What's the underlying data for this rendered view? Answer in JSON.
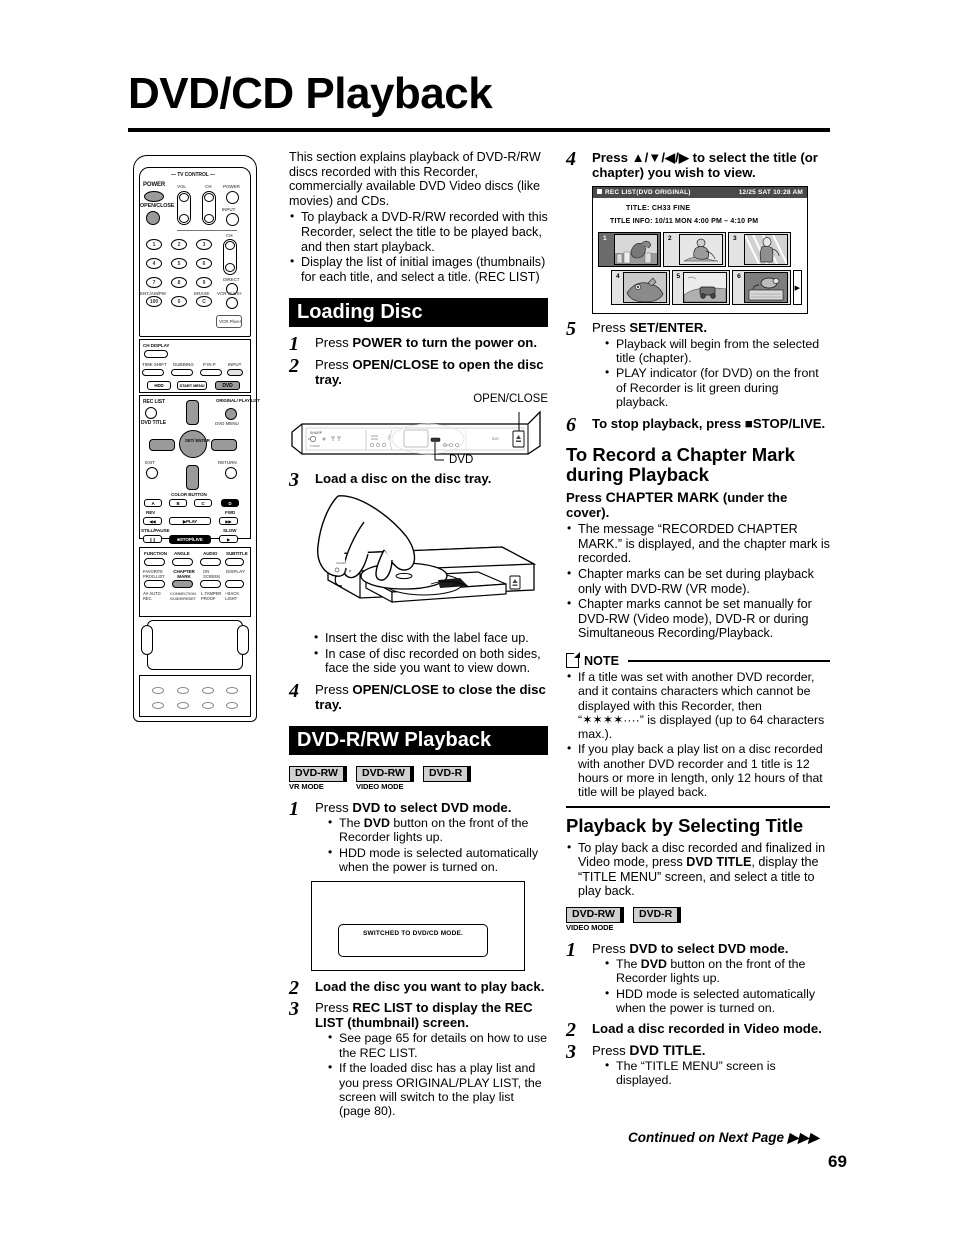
{
  "page": {
    "title": "DVD/CD Playback",
    "number": "69",
    "continued": "Continued on Next Page"
  },
  "intro": {
    "paragraph": "This section explains playback of DVD-R/RW discs recorded with this Recorder, commercially available DVD Video discs (like movies) and CDs.",
    "bullets": [
      "To playback a DVD-R/RW recorded with this Recorder, select the title to be played back, and then start playback.",
      "Display the list of initial images (thumbnails) for each title, and select a title. (REC LIST)"
    ]
  },
  "loading_disc": {
    "heading": "Loading Disc",
    "steps": [
      {
        "num": "1",
        "title_pre": "Press ",
        "title_bold": "POWER",
        "title_post": " to turn the power on."
      },
      {
        "num": "2",
        "title_pre": "Press ",
        "title_bold": "OPEN/CLOSE",
        "title_post": " to open the disc tray."
      },
      {
        "num": "3",
        "title_pre": "",
        "title_bold": "",
        "title_post": "Load a disc on the disc tray."
      },
      {
        "num": "4",
        "title_pre": "Press ",
        "title_bold": "OPEN/CLOSE",
        "title_post": " to close the disc tray."
      }
    ],
    "front_panel_labels": {
      "open_close": "OPEN/CLOSE",
      "dvd": "DVD"
    },
    "disc_bullets": [
      "Insert the disc with the label face up.",
      "In case of disc recorded on both sides, face the side you want to view down."
    ]
  },
  "dvd_rrw_playback": {
    "heading": "DVD-R/RW Playback",
    "badges": [
      {
        "label": "DVD-RW",
        "sub": "VR MODE"
      },
      {
        "label": "DVD-RW",
        "sub": "VIDEO MODE"
      },
      {
        "label": "DVD-R",
        "sub": ""
      }
    ],
    "step1": {
      "num": "1",
      "title_pre": "Press ",
      "title_bold": "DVD",
      "title_post": " to select DVD mode.",
      "bullets": [
        {
          "pre": "The ",
          "bold": "DVD",
          "post": " button on the front of the Recorder lights up."
        },
        {
          "pre": "",
          "bold": "",
          "post": "HDD mode is selected automatically when the power is turned on."
        }
      ],
      "osd_message": "SWITCHED TO DVD/CD MODE."
    },
    "step2": {
      "num": "2",
      "title": "Load the disc you want to play back."
    },
    "step3": {
      "num": "3",
      "title_pre": "Press ",
      "title_bold": "REC LIST",
      "title_post": " to display the REC LIST (thumbnail) screen.",
      "bullets": [
        "See page 65 for details on how to use the REC LIST.",
        "If the loaded disc has a play list and you press ORIGINAL/PLAY LIST, the screen will switch to the play list (page 80)."
      ]
    }
  },
  "right_column": {
    "step4": {
      "num": "4",
      "title": "Press ▲/▼/◀/▶ to select the title (or chapter) you wish to view."
    },
    "rec_list_osd": {
      "title": "REC LIST(DVD ORIGINAL)",
      "datetime": "12/25 SAT 10:28 AM",
      "title_line": "TITLE: CH33   FINE",
      "title_info": "TITLE INFO: 10/11 MON   4:00 PM – 4:10 PM",
      "thumbnails": [
        "1",
        "2",
        "3",
        "4",
        "5",
        "6"
      ],
      "selected_index": "1",
      "more_arrow": "▶"
    },
    "step5": {
      "num": "5",
      "title_pre": "Press ",
      "title_bold": "SET/ENTER",
      "title_post": ".",
      "bullets": [
        "Playback will begin from the selected title (chapter).",
        "PLAY indicator (for DVD) on the front of Recorder is lit green during playback."
      ]
    },
    "step6": {
      "num": "6",
      "title": "To stop playback, press ■STOP/LIVE."
    },
    "chapter_mark": {
      "heading": "To Record a Chapter Mark during Playback",
      "instruction_pre": "Press ",
      "instruction_bold": "CHAPTER MARK",
      "instruction_post": " (under the cover).",
      "bullets": [
        "The message “RECORDED CHAPTER MARK.” is displayed, and the chapter mark is recorded.",
        "Chapter marks can be set during playback only with DVD-RW (VR mode).",
        "Chapter marks cannot be set manually for DVD-RW (Video mode), DVD-R or during Simultaneous Recording/Playback."
      ]
    },
    "note": {
      "label": "NOTE",
      "bullets": [
        "If a title was set with another DVD recorder, and it contains characters which cannot be displayed with this Recorder, then “✶✶✶✶····” is displayed (up to 64 characters max.).",
        "If you play back a play list on a disc recorded with another DVD recorder and 1 title is 12 hours or more in length, only 12 hours of that title will be played back."
      ]
    },
    "playback_by_title": {
      "heading": "Playback by Selecting Title",
      "intro_bullet": {
        "pre": "To play back a disc recorded and finalized in Video mode, press ",
        "bold": "DVD TITLE",
        "post": ", display the “TITLE MENU” screen, and select a title to play back."
      },
      "badges": [
        {
          "label": "DVD-RW",
          "sub": "VIDEO MODE"
        },
        {
          "label": "DVD-R",
          "sub": ""
        }
      ],
      "step1": {
        "num": "1",
        "title_pre": "Press ",
        "title_bold": "DVD",
        "title_post": " to select DVD mode.",
        "bullets": [
          {
            "pre": "The ",
            "bold": "DVD",
            "post": " button on the front of the Recorder lights up."
          },
          {
            "pre": "",
            "bold": "",
            "post": "HDD mode is selected automatically when the power is turned on."
          }
        ]
      },
      "step2": {
        "num": "2",
        "title": "Load a disc recorded in Video mode."
      },
      "step3": {
        "num": "3",
        "title_pre": "Press ",
        "title_bold": "DVD TITLE",
        "title_post": ".",
        "bullets": [
          "The “TITLE MENU” screen is displayed."
        ]
      }
    }
  },
  "remote": {
    "tv_control_label": "— TV CONTROL —",
    "labels": {
      "power": "POWER",
      "vol": "VOL",
      "ch": "CH",
      "tv_power": "POWER",
      "open_close": "OPEN/CLOSE",
      "input": "INPUT",
      "ch2": "CH",
      "direct": "DIRECT",
      "ent_am_pm": "ENT./AM/PM",
      "erase": "ERASE",
      "vcr_plus": "VCR PLUS+",
      "ch_display": "CH DISPLAY",
      "time_shift": "TIME SHIFT",
      "dubbing": "DUBBING",
      "p_in_p": "P IN P",
      "input2": "INPUT",
      "hdd": "HDD",
      "start_menu": "START MENU",
      "dvd": "DVD",
      "rec_list": "REC LIST",
      "original_play_list": "ORIGINAL/ PLAY LIST",
      "dvd_title": "DVD TITLE",
      "dvd_menu": "DVD MENU",
      "set_enter": "SET/ ENTER",
      "exit": "EXIT",
      "return": "RETURN",
      "color_button": "COLOR BUTTON",
      "color_a": "A",
      "color_b": "B",
      "color_c": "C",
      "color_d": "D",
      "rev": "REV",
      "fwd": "FWD",
      "play": "▶PLAY",
      "still_pause": "STILL/PAUSE",
      "slow": "SLOW",
      "stop_live": "■STOP/LIVE",
      "function": "FUNCTION",
      "angle": "ANGLE",
      "audio": "AUDIO",
      "subtitle": "SUBTITLE",
      "favorite": "FAVORITE PROG.LIST",
      "chapter_mark": "CHAPTER MARK",
      "on_screen": "ON SCREEN",
      "display": "DISPLAY",
      "av_auto_rec": "AV AUTO REC",
      "connection_guide_reset": "CONNECTION GUIDE/RESET",
      "tamper_proof": "L TAMPER PROOF",
      "back_light": "• BACK LIGHT",
      "logo": "VCR Plus+"
    },
    "numbers": [
      "1",
      "2",
      "3",
      "4",
      "5",
      "6",
      "7",
      "8",
      "9",
      "100",
      "0",
      "C"
    ]
  }
}
